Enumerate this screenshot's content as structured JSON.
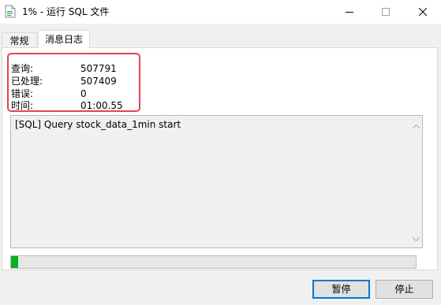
{
  "window": {
    "title": "1% - 运行 SQL 文件",
    "app_icon": "sql-file-icon",
    "controls": [
      "minimize-icon",
      "maximize-icon",
      "close-icon"
    ]
  },
  "tabs": [
    {
      "label": "常规",
      "active": false
    },
    {
      "label": "消息日志",
      "active": true
    }
  ],
  "stats": {
    "query_label": "查询:",
    "query_value": "507791",
    "processed_label": "已处理:",
    "processed_value": "507409",
    "errors_label": "错误:",
    "errors_value": "0",
    "time_label": "时间:",
    "time_value": "01:00.55"
  },
  "log": {
    "lines": [
      "[SQL] Query stock_data_1min start"
    ]
  },
  "progress": {
    "percent": 1,
    "color": "#06b025"
  },
  "buttons": {
    "pause_label": "暂停",
    "stop_label": "停止"
  },
  "colors": {
    "highlight_border": "#e8424f",
    "focus_border": "#0078d7"
  }
}
